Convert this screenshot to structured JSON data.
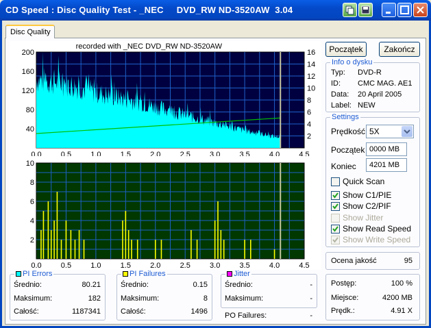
{
  "window": {
    "title": "CD Speed : Disc Quality Test - _NEC     DVD_RW ND-3520AW  3.04"
  },
  "tabs": [
    {
      "label": "Disc Quality"
    }
  ],
  "chart_header": "recorded with _NEC     DVD_RW ND-3520AW",
  "buttons": {
    "start": "Początek",
    "end": "Zakończ"
  },
  "disc_info": {
    "legend": "Info o dysku",
    "rows": [
      {
        "label": "Typ:",
        "value": "DVD-R"
      },
      {
        "label": "ID:",
        "value": "CMC MAG. AE1"
      },
      {
        "label": "Data:",
        "value": "20 April 2005"
      },
      {
        "label": "Label:",
        "value": "NEW"
      }
    ]
  },
  "settings": {
    "legend": "Settings",
    "speed_label": "Prędkość",
    "speed_value": "5X",
    "start_label": "Początek",
    "start_value": "0000 MB",
    "end_label": "Koniec",
    "end_value": "4201 MB",
    "checks": [
      {
        "label": "Quick Scan",
        "checked": false,
        "disabled": false
      },
      {
        "label": "Show C1/PIE",
        "checked": true,
        "disabled": false
      },
      {
        "label": "Show C2/PIF",
        "checked": true,
        "disabled": false
      },
      {
        "label": "Show Jitter",
        "checked": false,
        "disabled": true
      },
      {
        "label": "Show Read Speed",
        "checked": true,
        "disabled": false
      },
      {
        "label": "Show Write Speed",
        "checked": true,
        "disabled": true
      }
    ]
  },
  "quality": {
    "label": "Ocena jakość",
    "value": "95"
  },
  "progress": {
    "rows": [
      {
        "label": "Postęp:",
        "value": "100 %"
      },
      {
        "label": "Miejsce:",
        "value": "4200 MB"
      },
      {
        "label": "Prędk.:",
        "value": "4.91 X"
      }
    ]
  },
  "pi_errors": {
    "legend": "PI Errors",
    "rows": [
      {
        "label": "Średnio:",
        "value": "80.21"
      },
      {
        "label": "Maksimum:",
        "value": "182"
      },
      {
        "label": "Całość:",
        "value": "1187341"
      }
    ]
  },
  "pi_failures": {
    "legend": "PI Failures",
    "rows": [
      {
        "label": "Średnio:",
        "value": "0.15"
      },
      {
        "label": "Maksimum:",
        "value": "8"
      },
      {
        "label": "Całość:",
        "value": "1496"
      }
    ]
  },
  "jitter": {
    "legend": "Jitter",
    "rows": [
      {
        "label": "Średnio:",
        "value": "-"
      },
      {
        "label": "Maksimum:",
        "value": "-"
      }
    ]
  },
  "po_failures": {
    "label": "PO Failures:",
    "value": "-"
  },
  "colors": {
    "pie": "#00ffff",
    "pif": "#ffff00",
    "speed": "#00c000",
    "jitter": "#ff00ff",
    "top_bg": "#000040",
    "bottom_bg": "#003800",
    "grid": "#1e60c8",
    "marker": "#c8c8a0"
  },
  "chart_data": [
    {
      "type": "area",
      "name": "PI Errors / Read Speed",
      "xlim": [
        0,
        4.5
      ],
      "ylim": [
        0,
        200
      ],
      "y2lim": [
        0,
        16
      ],
      "x_ticks": [
        "0.0",
        "0.5",
        "1.0",
        "1.5",
        "2.0",
        "2.5",
        "3.0",
        "3.5",
        "4.0",
        "4.5"
      ],
      "y_ticks": [
        "200",
        "160",
        "120",
        "80",
        "40"
      ],
      "y2_ticks": [
        "16",
        "14",
        "12",
        "10",
        "8",
        "6",
        "4",
        "2"
      ],
      "series": [
        {
          "name": "PI Errors",
          "x": [
            0.0,
            0.3,
            0.5,
            0.8,
            1.0,
            1.2,
            1.5,
            1.8,
            2.0,
            2.3,
            2.5,
            2.8,
            3.0,
            3.3,
            3.5,
            3.8,
            4.0,
            4.1
          ],
          "values": [
            150,
            145,
            140,
            130,
            122,
            115,
            108,
            98,
            90,
            80,
            72,
            62,
            55,
            45,
            38,
            30,
            25,
            24
          ]
        },
        {
          "name": "Read Speed",
          "x": [
            0.0,
            4.1
          ],
          "values": [
            2.4,
            5.0
          ]
        }
      ]
    },
    {
      "type": "bar",
      "name": "PI Failures",
      "xlim": [
        0,
        4.5
      ],
      "ylim": [
        0,
        10
      ],
      "x_ticks": [
        "0.0",
        "0.5",
        "1.0",
        "1.5",
        "2.0",
        "2.5",
        "3.0",
        "3.5",
        "4.0",
        "4.5"
      ],
      "y_ticks": [
        "10",
        "8",
        "6",
        "4",
        "2"
      ],
      "series": [
        {
          "name": "PI Failures",
          "x": [
            0.08,
            0.12,
            0.2,
            0.25,
            0.3,
            0.35,
            0.42,
            0.5,
            0.58,
            0.65,
            0.72,
            0.8,
            1.45,
            1.5,
            1.55,
            1.6,
            1.7,
            2.0,
            2.1,
            2.6,
            2.7,
            3.0,
            3.05,
            3.1,
            3.15,
            3.5,
            3.6,
            4.0
          ],
          "values": [
            3,
            5,
            6,
            3,
            4,
            7,
            2,
            4,
            3,
            2,
            3,
            2,
            4,
            5,
            3,
            2,
            2,
            2,
            2,
            3,
            2,
            4,
            6,
            3,
            2,
            2,
            2,
            1
          ]
        }
      ]
    }
  ]
}
